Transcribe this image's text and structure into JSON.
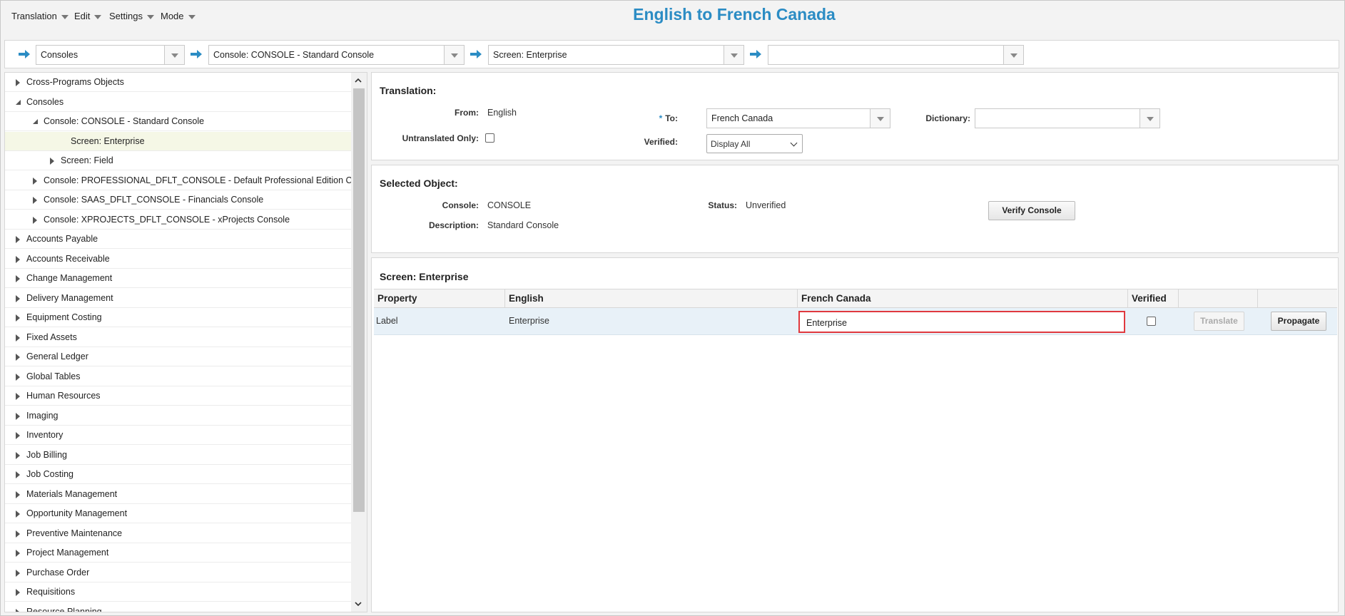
{
  "menu": {
    "translation": "Translation",
    "edit": "Edit",
    "settings": "Settings",
    "mode": "Mode"
  },
  "app_title": "English to French Canada",
  "breadcrumb": {
    "item1": "Consoles",
    "item2": "Console: CONSOLE - Standard Console",
    "item3": "Screen: Enterprise",
    "item4": ""
  },
  "tree": [
    {
      "label": "Cross-Programs Objects",
      "level": 0,
      "state": "closed"
    },
    {
      "label": "Consoles",
      "level": 0,
      "state": "open"
    },
    {
      "label": "Console: CONSOLE - Standard Console",
      "level": 1,
      "state": "open"
    },
    {
      "label": "Screen: Enterprise",
      "level": 2,
      "state": "none",
      "selected": true
    },
    {
      "label": "Screen: Field",
      "level": 2,
      "state": "closed"
    },
    {
      "label": "Console: PROFESSIONAL_DFLT_CONSOLE - Default Professional Edition Cc",
      "level": 1,
      "state": "closed"
    },
    {
      "label": "Console: SAAS_DFLT_CONSOLE - Financials Console",
      "level": 1,
      "state": "closed"
    },
    {
      "label": "Console: XPROJECTS_DFLT_CONSOLE - xProjects Console",
      "level": 1,
      "state": "closed"
    },
    {
      "label": "Accounts Payable",
      "level": 0,
      "state": "closed"
    },
    {
      "label": "Accounts Receivable",
      "level": 0,
      "state": "closed"
    },
    {
      "label": "Change Management",
      "level": 0,
      "state": "closed"
    },
    {
      "label": "Delivery Management",
      "level": 0,
      "state": "closed"
    },
    {
      "label": "Equipment Costing",
      "level": 0,
      "state": "closed"
    },
    {
      "label": "Fixed Assets",
      "level": 0,
      "state": "closed"
    },
    {
      "label": "General Ledger",
      "level": 0,
      "state": "closed"
    },
    {
      "label": "Global Tables",
      "level": 0,
      "state": "closed"
    },
    {
      "label": "Human Resources",
      "level": 0,
      "state": "closed"
    },
    {
      "label": "Imaging",
      "level": 0,
      "state": "closed"
    },
    {
      "label": "Inventory",
      "level": 0,
      "state": "closed"
    },
    {
      "label": "Job Billing",
      "level": 0,
      "state": "closed"
    },
    {
      "label": "Job Costing",
      "level": 0,
      "state": "closed"
    },
    {
      "label": "Materials Management",
      "level": 0,
      "state": "closed"
    },
    {
      "label": "Opportunity Management",
      "level": 0,
      "state": "closed"
    },
    {
      "label": "Preventive Maintenance",
      "level": 0,
      "state": "closed"
    },
    {
      "label": "Project Management",
      "level": 0,
      "state": "closed"
    },
    {
      "label": "Purchase Order",
      "level": 0,
      "state": "closed"
    },
    {
      "label": "Requisitions",
      "level": 0,
      "state": "closed"
    },
    {
      "label": "Resource Planning",
      "level": 0,
      "state": "closed"
    }
  ],
  "translation_panel": {
    "title": "Translation:",
    "from_label": "From:",
    "from_value": "English",
    "to_required": "*",
    "to_label": "To:",
    "to_value": "French Canada",
    "dictionary_label": "Dictionary:",
    "dictionary_value": "",
    "untranslated_label": "Untranslated Only:",
    "untranslated_checked": false,
    "verified_label": "Verified:",
    "verified_value": "Display All"
  },
  "selected_object": {
    "title": "Selected Object:",
    "console_label": "Console:",
    "console_value": "CONSOLE",
    "status_label": "Status:",
    "status_value": "Unverified",
    "description_label": "Description:",
    "description_value": "Standard Console",
    "verify_button": "Verify Console"
  },
  "screen_panel": {
    "title": "Screen: Enterprise",
    "columns": [
      "Property",
      "English",
      "French Canada",
      "Verified",
      "",
      ""
    ],
    "rows": [
      {
        "property": "Label",
        "english": "Enterprise",
        "french": "Enterprise",
        "verified": false,
        "translate": "Translate",
        "propagate": "Propagate"
      }
    ]
  }
}
